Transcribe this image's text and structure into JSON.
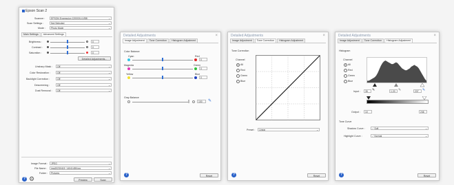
{
  "main": {
    "title": "Epson Scan 2",
    "scanner_label": "Scanner :",
    "scanner_value": "EPSON Expression 12000XL(USB)",
    "scan_settings_label": "Scan Settings :",
    "scan_settings_value": "Not Selected",
    "mode_label": "Mode :",
    "mode_value": "Photo Mode",
    "tab_main": "Main Settings",
    "tab_advanced": "Advanced Settings",
    "brightness_label": "Brightness :",
    "brightness_value": "0",
    "contrast_label": "Contrast :",
    "contrast_value": "0",
    "saturation_label": "Saturation :",
    "saturation_value": "0",
    "detailed_button": "Detailed Adjustments...",
    "unsharp_label": "Unsharp Mask :",
    "unsharp_value": "Off",
    "color_restoration_label": "Color Restoration :",
    "color_restoration_value": "Off",
    "backlight_label": "Backlight Correction :",
    "backlight_value": "Off",
    "descreening_label": "Descreening :",
    "descreening_value": "Off",
    "dust_label": "Dust Removal :",
    "dust_value": "Off",
    "image_format_label": "Image Format :",
    "image_format_value": "JPEG",
    "file_name_label": "File Name :",
    "file_name_value": "img20230415_14041455.jpg",
    "folder_label": "Folder :",
    "folder_value": "Pictures",
    "preview_button": "Preview",
    "scan_button": "Scan"
  },
  "win2": {
    "title": "Detailed Adjustments",
    "tabs": [
      "Image Adjustment",
      "Tone Correction",
      "Histogram Adjustment"
    ],
    "color_balance_label": "Color Balance",
    "cyan": "Cyan",
    "red": "Red",
    "magenta": "Magenta",
    "green": "Green",
    "yellow": "Yellow",
    "blue": "Blue",
    "v1": "0",
    "v2": "0",
    "v3": "0",
    "gray_balance_label": "Gray Balance",
    "gray_value": "100",
    "reset_button": "Reset"
  },
  "win3": {
    "title": "Detailed Adjustments",
    "tabs": [
      "Image Adjustment",
      "Tone Correction",
      "Histogram Adjustment"
    ],
    "section_label": "Tone Correction",
    "channel_label": "Channel",
    "channels": [
      "All",
      "Red",
      "Green",
      "Blue"
    ],
    "preset_label": "Preset :",
    "preset_value": "Linear",
    "reset_button": "Reset"
  },
  "win4": {
    "title": "Detailed Adjustments",
    "tabs": [
      "Image Adjustment",
      "Tone Correction",
      "Histogram Adjustment"
    ],
    "section_label": "Histogram",
    "channel_label": "Channel",
    "channels": [
      "All",
      "Red",
      "Green",
      "Blue"
    ],
    "input_label": "Input :",
    "input_low": "35",
    "input_gamma": "1.20",
    "input_high": "237",
    "output_label": "Output :",
    "output_low": "10",
    "output_high": "246",
    "tone_curve_label": "Tone Curve",
    "shadow_label": "Shadow Curve :",
    "shadow_value": "Soft",
    "highlight_label": "Highlight Curve :",
    "highlight_value": "Normal",
    "reset_button": "Reset"
  },
  "colors": {
    "accent": "#2f6fd6",
    "help": "#2a62c9"
  },
  "histogram": [
    2,
    2,
    3,
    4,
    5,
    6,
    8,
    11,
    15,
    19,
    22,
    24,
    25,
    24,
    23,
    22,
    21,
    21,
    22,
    23,
    22,
    20,
    18,
    16,
    15,
    14,
    14,
    15,
    16,
    18,
    19,
    20,
    19,
    18,
    16,
    13,
    10,
    7,
    4,
    2
  ]
}
